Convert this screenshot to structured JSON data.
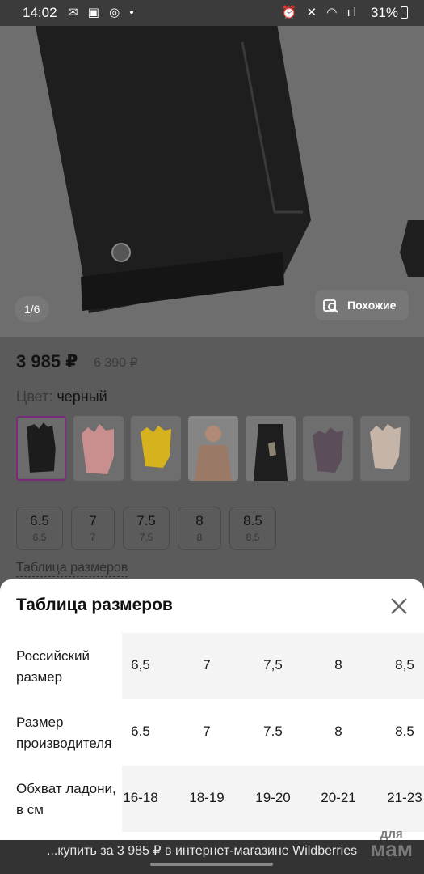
{
  "status_bar": {
    "time": "14:02",
    "left_icons": "✉ ▣ ◎ •",
    "right_icons": "⏰ ✕ ◠ ıl",
    "battery": "31%"
  },
  "gallery": {
    "counter": "1/6",
    "similar_label": "Похожие"
  },
  "product": {
    "price": "3 985 ₽",
    "old_price": "6 390 ₽",
    "color_label": "Цвет:",
    "color_value": "черный",
    "swatch_colors": [
      "#1c1c1c",
      "#c98f8f",
      "#d6b21e",
      "#9a7a66",
      "#1e1e1e",
      "#5b4d5a",
      "#c4b5a8"
    ],
    "sizes": [
      {
        "main": "6.5",
        "sub": "6,5"
      },
      {
        "main": "7",
        "sub": "7"
      },
      {
        "main": "7.5",
        "sub": "7,5"
      },
      {
        "main": "8",
        "sub": "8"
      },
      {
        "main": "8.5",
        "sub": "8,5"
      }
    ],
    "size_table_link": "Таблица размеров"
  },
  "size_sheet": {
    "title": "Таблица размеров",
    "rows": [
      {
        "label": "Российский размер",
        "values": [
          "6,5",
          "7",
          "7,5",
          "8",
          "8,5"
        ]
      },
      {
        "label": "Размер производителя",
        "values": [
          "6.5",
          "7",
          "7.5",
          "8",
          "8.5"
        ]
      },
      {
        "label": "Обхват ладони, в см",
        "values": [
          "16-18",
          "18-19",
          "19-20",
          "20-21",
          "21-23"
        ]
      }
    ]
  },
  "bottom_bar": {
    "text": "...купить за 3 985 ₽ в интернет-магазине Wildberries"
  },
  "watermark": {
    "small": "для",
    "big": "мам"
  }
}
